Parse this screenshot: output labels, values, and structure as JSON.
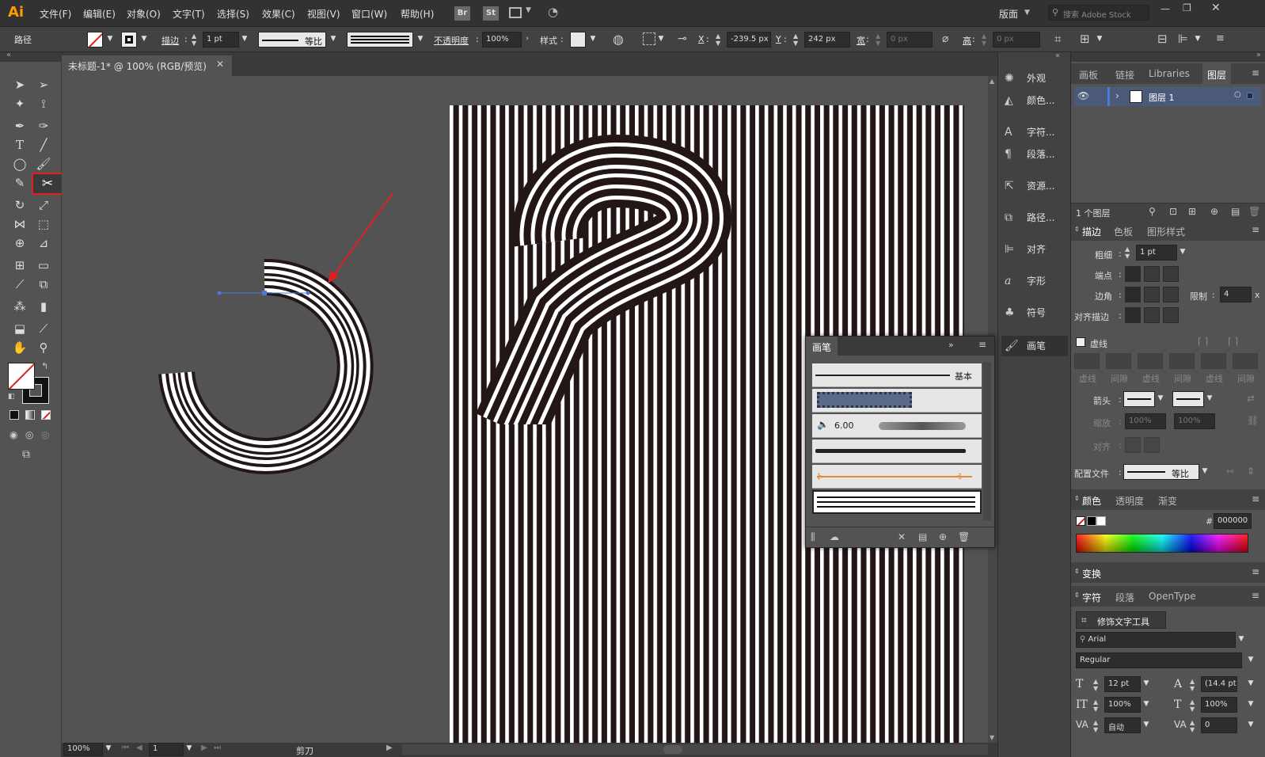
{
  "app": {
    "logo": "Ai"
  },
  "menubar": {
    "items": [
      "文件(F)",
      "编辑(E)",
      "对象(O)",
      "文字(T)",
      "选择(S)",
      "效果(C)",
      "视图(V)",
      "窗口(W)",
      "帮助(H)"
    ],
    "br": "Br",
    "st": "St",
    "workspace": "版面",
    "search_placeholder": "搜索 Adobe Stock"
  },
  "control": {
    "selection": "路径",
    "stroke_label": "描边",
    "stroke_weight": "1 pt",
    "profile": "等比",
    "opacity_label": "不透明度",
    "opacity": "100%",
    "style_label": "样式",
    "x_label": "X",
    "x_value": "-239.5 px",
    "y_label": "Y",
    "y_value": "242 px",
    "w_label": "宽",
    "w_value": "0 px",
    "h_label": "高",
    "h_value": "0 px"
  },
  "document": {
    "tab_title": "未标题-1* @ 100% (RGB/预览)"
  },
  "status": {
    "zoom": "100%",
    "artboard": "1",
    "tool": "剪刀"
  },
  "icon_panels": [
    "外观",
    "颜色...",
    "字符...",
    "段落...",
    "资源...",
    "路径...",
    "对齐",
    "字形",
    "符号",
    "画笔"
  ],
  "layers_panel": {
    "tabs": [
      "画板",
      "链接",
      "Libraries",
      "图层"
    ],
    "layer_name": "图层 1",
    "count": "1 个图层"
  },
  "stroke_panel": {
    "tabs": [
      "描边",
      "色板",
      "图形样式"
    ],
    "weight_label": "粗细",
    "weight": "1 pt",
    "cap_label": "端点",
    "corner_label": "边角",
    "limit_label": "限制",
    "limit": "4",
    "align_label": "对齐描边",
    "dashed_label": "虚线",
    "dash_labels": [
      "虚线",
      "间隙",
      "虚线",
      "间隙",
      "虚线",
      "间隙"
    ],
    "arrow_label": "箭头",
    "scale_label": "缩放",
    "scale1": "100%",
    "scale2": "100%",
    "align2_label": "对齐",
    "profile_label": "配置文件",
    "profile": "等比"
  },
  "color_panel": {
    "tabs": [
      "颜色",
      "透明度",
      "渐变"
    ],
    "hex": "000000"
  },
  "transform_panel": {
    "title": "变换"
  },
  "char_panel": {
    "tabs": [
      "字符",
      "段落",
      "OpenType"
    ],
    "touch_tool": "修饰文字工具",
    "font": "Arial",
    "style": "Regular",
    "size": "12 pt",
    "leading": "(14.4 pt)",
    "vscale": "100%",
    "hscale": "100%",
    "kerning": "自动",
    "tracking": "0"
  },
  "brush_panel": {
    "title": "画笔",
    "basic_label": "基本",
    "size_label": "6.00"
  },
  "colors": {
    "accent_highlight": "#e02020",
    "selection_blue": "#4a7bd8",
    "stripe_dark": "#2a1a1a"
  }
}
